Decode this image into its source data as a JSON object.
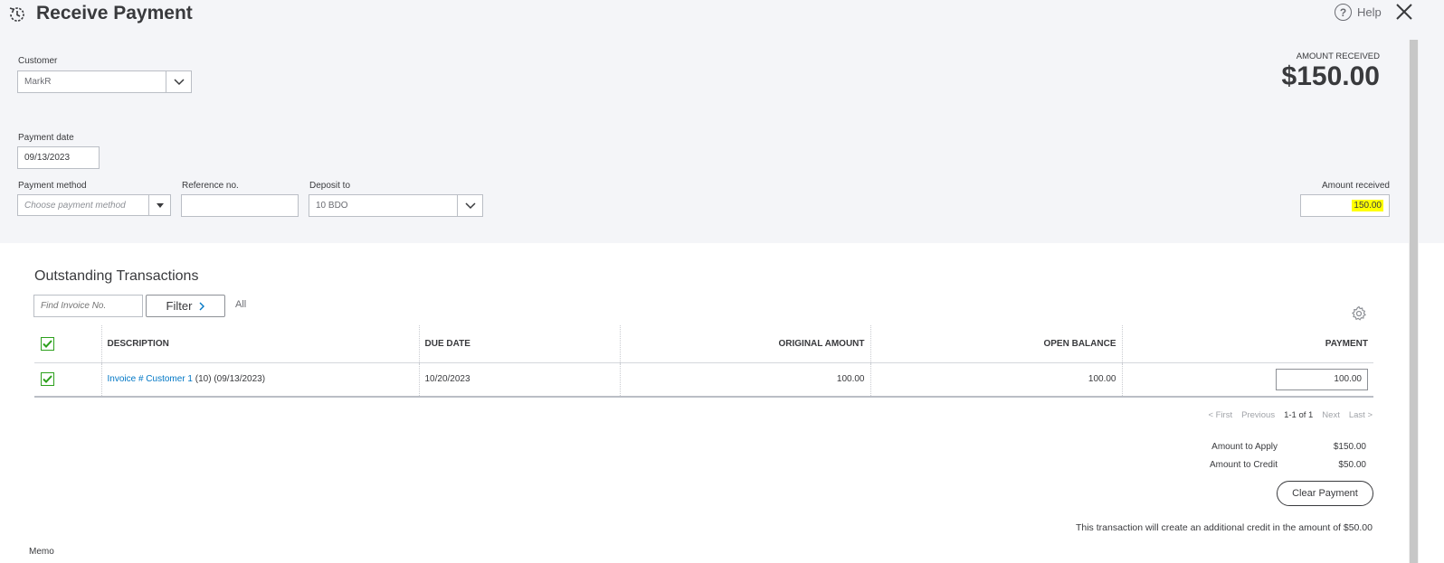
{
  "header": {
    "title": "Receive Payment",
    "help": "Help"
  },
  "customer": {
    "label": "Customer",
    "value": "MarkR"
  },
  "amount_received_top": {
    "label": "AMOUNT RECEIVED",
    "value": "$150.00"
  },
  "payment_date": {
    "label": "Payment date",
    "value": "09/13/2023"
  },
  "payment_method": {
    "label": "Payment method",
    "placeholder": "Choose payment method"
  },
  "reference": {
    "label": "Reference no.",
    "value": ""
  },
  "deposit_to": {
    "label": "Deposit to",
    "value": "10 BDO"
  },
  "amount_received": {
    "label": "Amount received",
    "value": "150.00",
    "highlight": "#ffff00"
  },
  "outstanding": {
    "title": "Outstanding Transactions",
    "find_placeholder": "Find Invoice No.",
    "filter_label": "Filter",
    "all_label": "All",
    "columns": [
      "DESCRIPTION",
      "DUE DATE",
      "ORIGINAL AMOUNT",
      "OPEN BALANCE",
      "PAYMENT"
    ],
    "rows": [
      {
        "checked": true,
        "desc_link": "Invoice # Customer 1",
        "desc_rest": " (10) (09/13/2023)",
        "due": "10/20/2023",
        "original": "100.00",
        "open": "100.00",
        "payment": "100.00"
      }
    ]
  },
  "pager": {
    "first": "< First",
    "previous": "Previous",
    "current": "1-1 of 1",
    "next": "Next",
    "last": "Last >"
  },
  "totals": {
    "apply_label": "Amount to Apply",
    "apply_value": "$150.00",
    "credit_label": "Amount to Credit",
    "credit_value": "$50.00"
  },
  "clear_payment": "Clear Payment",
  "credit_note": "This transaction will create an additional credit in the amount of $50.00",
  "memo_label": "Memo",
  "colors": {
    "accent_green": "#2ca01c",
    "link_blue": "#0077c5",
    "panel_bg": "#f4f5f8"
  }
}
